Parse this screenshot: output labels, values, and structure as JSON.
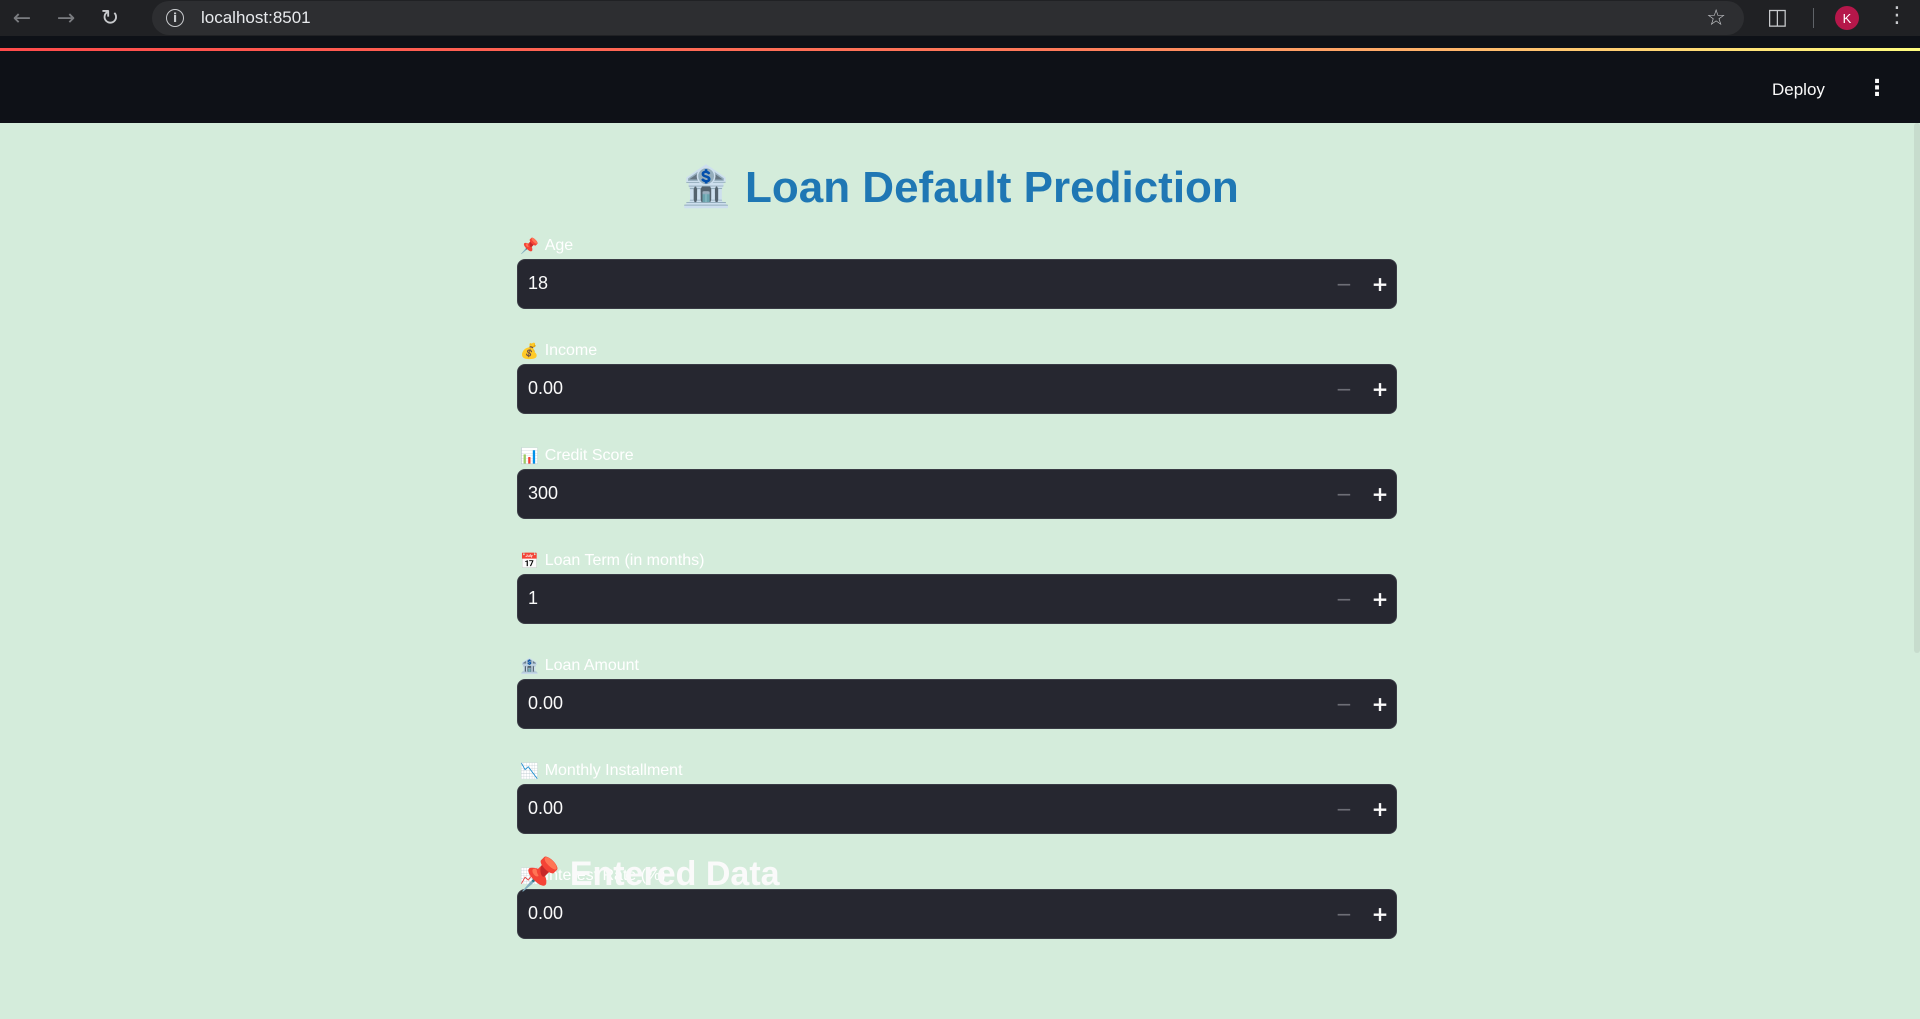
{
  "browser": {
    "url": "localhost:8501",
    "avatar_letter": "K",
    "back_icon": "arrow-left-icon",
    "forward_icon": "arrow-right-icon",
    "reload_icon": "reload-icon"
  },
  "app_header": {
    "deploy_label": "Deploy",
    "menu_icon": "kebab-menu-icon",
    "decoration_colors": [
      "#ff4b4b",
      "#ff7a5a",
      "#fffd80"
    ]
  },
  "title": {
    "emoji": "🏦",
    "text": "Loan Default Prediction",
    "color": "#1f77b4"
  },
  "fields": [
    {
      "emoji": "📌",
      "label": "Age",
      "value": "18"
    },
    {
      "emoji": "💰",
      "label": "Income",
      "value": "0.00"
    },
    {
      "emoji": "📊",
      "label": "Credit Score",
      "value": "300"
    },
    {
      "emoji": "📅",
      "label": "Loan Term (in months)",
      "value": "1"
    },
    {
      "emoji": "🏦",
      "label": "Loan Amount",
      "value": "0.00"
    },
    {
      "emoji": "📉",
      "label": "Monthly Installment",
      "value": "0.00"
    },
    {
      "emoji": "📈",
      "label": "Interest Rate (%)",
      "value": "0.00"
    }
  ],
  "stepper": {
    "minus": "−",
    "plus": "+"
  },
  "section": {
    "emoji": "📌",
    "text": "Entered Data"
  },
  "colors": {
    "page_background": "#d4ecdb",
    "input_background": "#262730",
    "header_background": "#0e1117"
  }
}
